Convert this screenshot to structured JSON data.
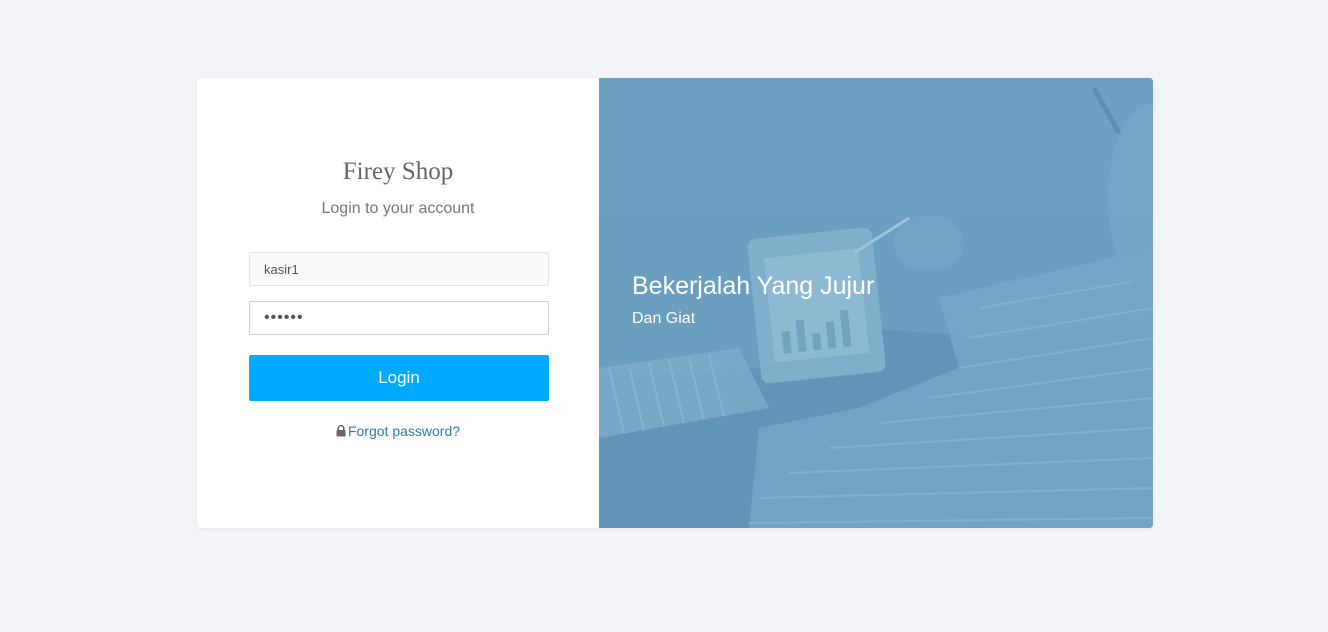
{
  "brand": {
    "title": "Firey Shop"
  },
  "login": {
    "subtitle": "Login to your account",
    "username_value": "kasir1",
    "password_value": "••••••",
    "submit_label": "Login",
    "forgot_label": "Forgot password?"
  },
  "hero": {
    "title": "Bekerjalah Yang Jujur",
    "subtitle": "Dan Giat"
  },
  "colors": {
    "page_bg": "#f3f4f8",
    "button": "#00aaff",
    "link": "#2b7bb0",
    "hero_overlay": "#6a9fbf"
  },
  "icons": {
    "forgot": "lock-icon"
  }
}
